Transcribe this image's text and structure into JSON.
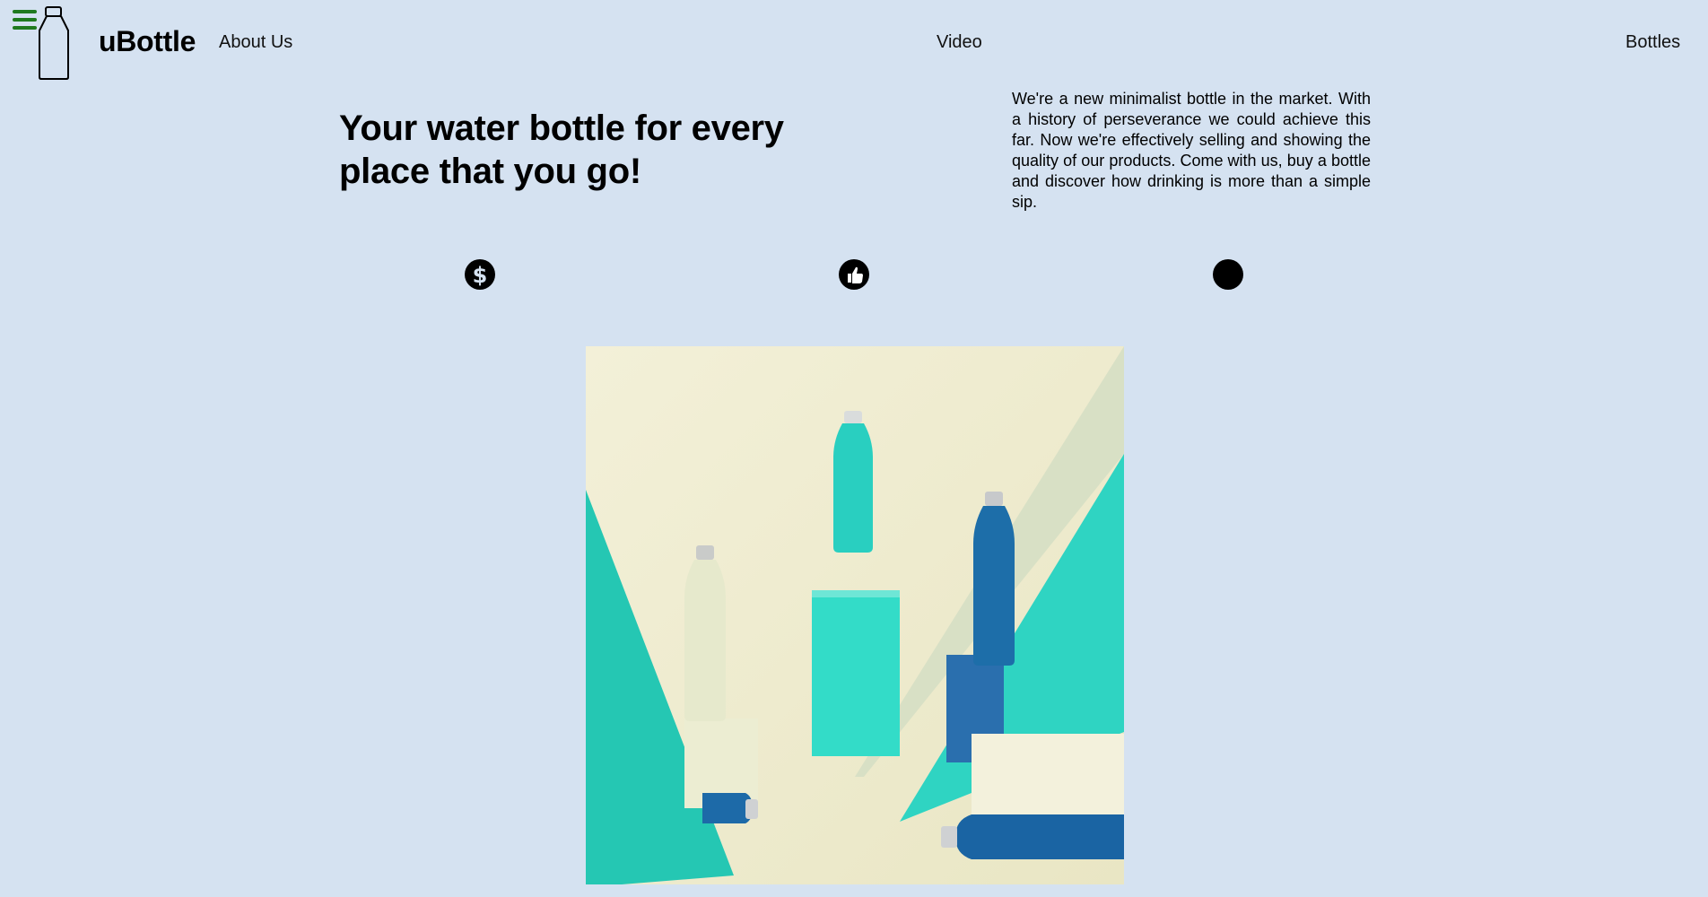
{
  "header": {
    "brand": "uBottle",
    "menu_icon": "hamburger-menu-icon",
    "logo_icon": "bottle-logo-icon",
    "nav": {
      "about": "About Us",
      "video": "Video",
      "bottles": "Bottles"
    }
  },
  "hero": {
    "title": "Your water bottle for every place that you go!",
    "description": "We're a new minimalist bottle in the market. With a history of perseverance we could achieve this far. Now we're effectively selling and showing the quality of our products. Come with us, buy a bottle and discover how drinking is more than a simple sip."
  },
  "features": {
    "icons": [
      "dollar-icon",
      "thumbs-up-icon",
      "circle-icon"
    ]
  },
  "colors": {
    "background": "#d5e2f1",
    "menu_accent": "#1f7a1f",
    "teal": "#2fd4c2",
    "blue": "#1a6aa8",
    "cream": "#f1efd2"
  }
}
